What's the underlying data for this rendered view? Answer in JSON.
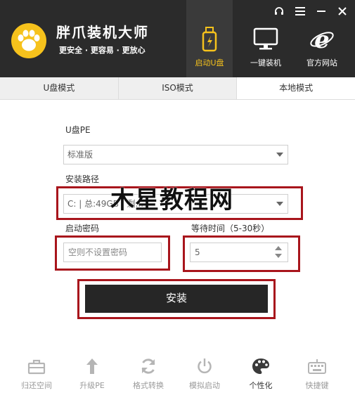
{
  "header": {
    "app_title": "胖爪装机大师",
    "slogan": "更安全 · 更容易 · 更放心",
    "nav": [
      {
        "label": "启动U盘",
        "icon": "usb-drive-icon",
        "active": true
      },
      {
        "label": "一键装机",
        "icon": "monitor-icon",
        "active": false
      },
      {
        "label": "官方网站",
        "icon": "ie-browser-icon",
        "active": false
      }
    ],
    "window_controls": [
      "headset-icon",
      "menu-icon",
      "minimize-icon",
      "close-icon"
    ]
  },
  "tabs": [
    {
      "label": "U盘模式",
      "active": false
    },
    {
      "label": "ISO模式",
      "active": false
    },
    {
      "label": "本地模式",
      "active": true
    }
  ],
  "form": {
    "pe_label": "U盘PE",
    "pe_value": "标准版",
    "path_label": "安装路径",
    "path_value": "C: | 总:49GB | 剩...",
    "password_label": "启动密码",
    "password_placeholder": "空则不设置密码",
    "wait_label": "等待时间（5-30秒）",
    "wait_value": "5",
    "install_label": "安装",
    "watermark": "木星教程网"
  },
  "toolbar": [
    {
      "label": "归还空间",
      "icon": "toolbox-icon",
      "active": false
    },
    {
      "label": "升级PE",
      "icon": "upgrade-arrow-icon",
      "active": false
    },
    {
      "label": "格式转换",
      "icon": "refresh-icon",
      "active": false
    },
    {
      "label": "模拟启动",
      "icon": "power-icon",
      "active": false
    },
    {
      "label": "个性化",
      "icon": "palette-icon",
      "active": true
    },
    {
      "label": "快捷键",
      "icon": "keyboard-icon",
      "active": false
    }
  ],
  "colors": {
    "header_bg": "#2b2b2b",
    "accent_yellow": "#f6c21c",
    "highlight_red": "#a8151c",
    "button_dark": "#262626"
  }
}
